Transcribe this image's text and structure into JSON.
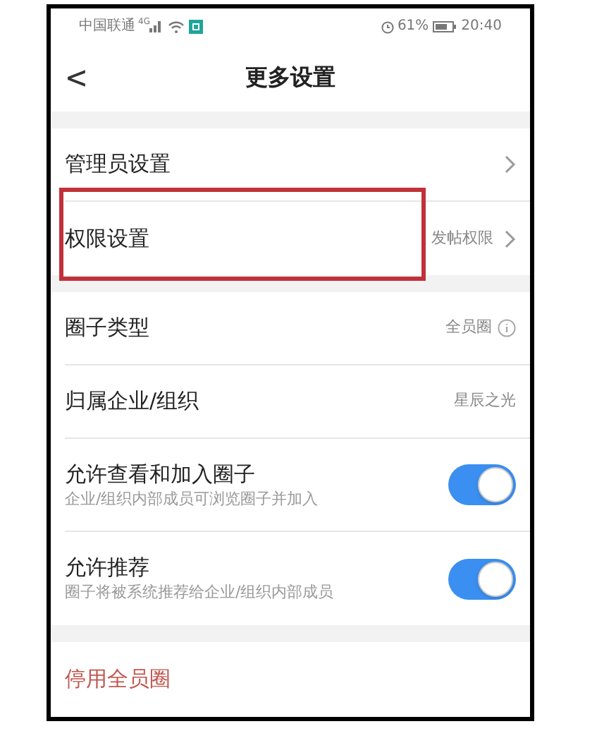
{
  "status_bar": {
    "carrier": "中国联通",
    "network": "4G",
    "battery": "61%",
    "time": "20:40"
  },
  "nav": {
    "back": "<",
    "title": "更多设置"
  },
  "sections": [
    {
      "rows": [
        {
          "kind": "link",
          "label": "管理员设置",
          "highlighted": false
        },
        {
          "kind": "link",
          "label": "权限设置",
          "value": "发帖权限",
          "highlighted": true
        }
      ]
    },
    {
      "rows": [
        {
          "kind": "info",
          "label": "圈子类型",
          "value": "全员圈"
        },
        {
          "kind": "text",
          "label": "归属企业/组织",
          "value": "星辰之光"
        },
        {
          "kind": "toggle",
          "label": "允许查看和加入圈子",
          "sub": "企业/组织内部成员可浏览圈子并加入",
          "on": true
        },
        {
          "kind": "toggle",
          "label": "允许推荐",
          "sub": "圈子将被系统推荐给企业/组织内部成员",
          "on": true
        }
      ]
    },
    {
      "rows": [
        {
          "kind": "danger",
          "label": "停用全员圈"
        }
      ]
    }
  ]
}
